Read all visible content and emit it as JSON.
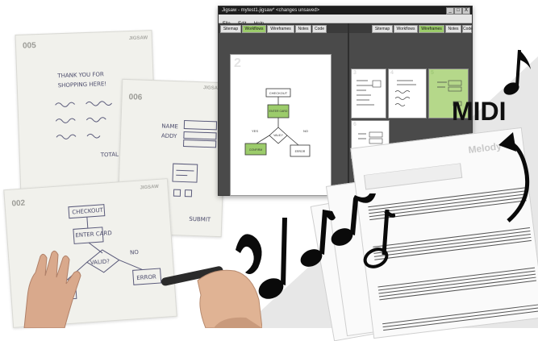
{
  "window": {
    "title": "Jigsaw - mytest1.jigsaw* <changes unsaved>",
    "menu": [
      "File",
      "Edit",
      "Help"
    ],
    "left_tabs": [
      "Sitemap",
      "Workflows",
      "Wireframes",
      "Notes",
      "Code"
    ],
    "right_tabs": [
      "Sitemap",
      "Workflows",
      "Wireframes",
      "Notes",
      "Code"
    ],
    "active_left_tab": "Workflows",
    "active_right_tab": "Wireframes",
    "big_page_number": "2",
    "big_page_labels": {
      "checkout": "CHECKOUT",
      "enter_card": "ENTER CARD",
      "valid": "VALID?",
      "yes": "YES",
      "no": "NO",
      "confirm": "CONFIRM",
      "error": "ERROR"
    },
    "thumb_numbers": [
      "3",
      "4",
      "5",
      "6"
    ],
    "win_buttons": [
      "_",
      "□",
      "X"
    ],
    "accent_green": "#9ccc6b"
  },
  "sheets": {
    "s005": {
      "number": "005",
      "brand": "JIGSAW",
      "lines": [
        "THANK YOU FOR",
        "SHOPPING HERE!",
        "TOTAL"
      ]
    },
    "s006": {
      "number": "006",
      "brand": "JIGSAW",
      "lines": [
        "NAME",
        "ADDY",
        "SUBMIT"
      ]
    },
    "s002": {
      "number": "002",
      "brand": "JIGSAW",
      "lines": [
        "CHECKOUT",
        "ENTER CARD",
        "VALID?",
        "NO",
        "ERROR"
      ]
    }
  },
  "music": {
    "melody_label": "Melody",
    "midi_label": "MIDI"
  },
  "colors": {
    "pane_dark": "#4a4a4a",
    "highlight_green": "#9ccc6b",
    "ink": "#101010"
  }
}
